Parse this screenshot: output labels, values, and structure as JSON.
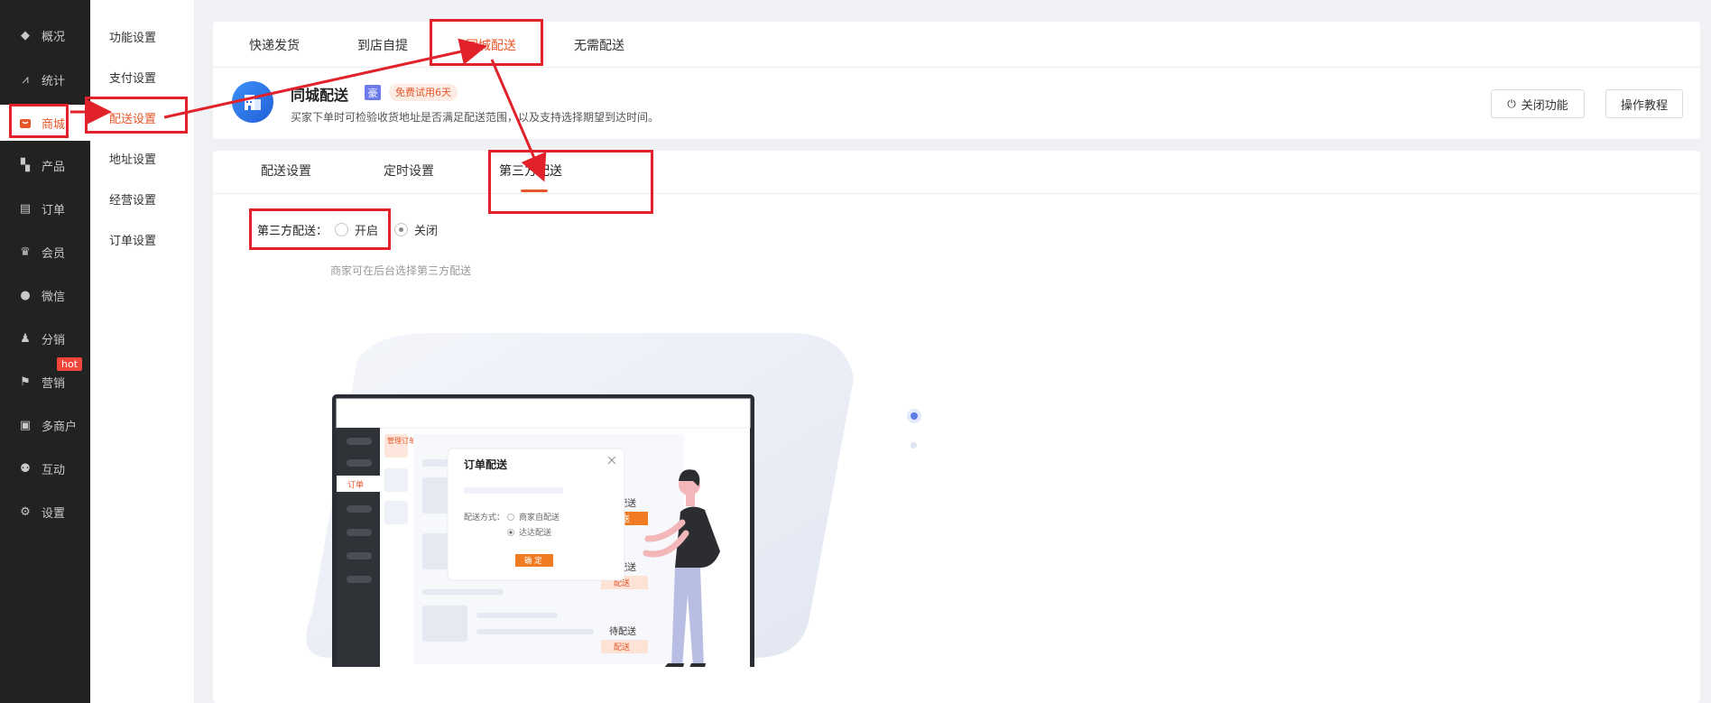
{
  "sidebar": {
    "items": [
      {
        "label": "概况",
        "icon": "layers-icon"
      },
      {
        "label": "统计",
        "icon": "chart-icon"
      },
      {
        "label": "商城",
        "icon": "shop-icon"
      },
      {
        "label": "产品",
        "icon": "grid-icon"
      },
      {
        "label": "订单",
        "icon": "clipboard-icon"
      },
      {
        "label": "会员",
        "icon": "crown-icon"
      },
      {
        "label": "微信",
        "icon": "wechat-icon"
      },
      {
        "label": "分销",
        "icon": "users-icon"
      },
      {
        "label": "营销",
        "icon": "flag-icon"
      },
      {
        "label": "多商户",
        "icon": "store-icon"
      },
      {
        "label": "互动",
        "icon": "people-icon"
      },
      {
        "label": "设置",
        "icon": "gear-icon"
      }
    ],
    "active": "商城",
    "hot_badge": "hot"
  },
  "submenu": {
    "items": [
      "功能设置",
      "支付设置",
      "配送设置",
      "地址设置",
      "经营设置",
      "订单设置"
    ],
    "active": "配送设置"
  },
  "delivery_tabs": {
    "items": [
      "快递发货",
      "到店自提",
      "同城配送",
      "无需配送"
    ],
    "active": "同城配送"
  },
  "feature": {
    "title": "同城配送",
    "tag_blue": "豪",
    "tag_trial": "免费试用6天",
    "description": "买家下单时可检验收货地址是否满足配送范围，以及支持选择期望到达时间。",
    "btn_close": "关闭功能",
    "btn_tutorial": "操作教程"
  },
  "sub_tabs": {
    "items": [
      "配送设置",
      "定时设置",
      "第三方配送"
    ],
    "active": "第三方配送"
  },
  "third_party": {
    "label": "第三方配送：",
    "option_on": "开启",
    "option_off": "关闭",
    "selected": "关闭",
    "hint": "商家可在后台选择第三方配送"
  },
  "illustration": {
    "side_tag": "管理订单",
    "side_order": "订单",
    "dialog_title": "订单配送",
    "method_label": "配送方式：",
    "method_opt1": "商家自配送",
    "method_opt2": "达达配送",
    "confirm_btn": "确 定",
    "pending1": "待配送",
    "pending2": "待配送",
    "pending3": "待配送",
    "ship1": "配送",
    "ship2": "配送",
    "ship3": "配送"
  },
  "colors": {
    "accent": "#e7572a",
    "sidebar_bg": "#222222",
    "annotation_red": "#e2222a"
  }
}
